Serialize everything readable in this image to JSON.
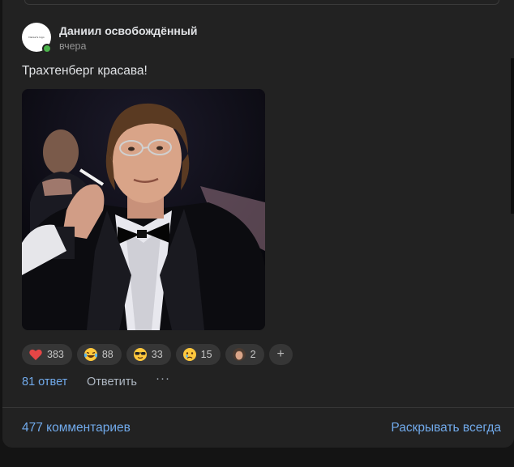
{
  "post": {
    "author": "Даниил освобождённый",
    "time": "вчера",
    "text": "Трахтенберг красава!",
    "avatar_text": "Daniel's logo"
  },
  "reactions": [
    {
      "icon": "heart-icon",
      "count": "383"
    },
    {
      "icon": "laughing-emoji-icon",
      "count": "88"
    },
    {
      "icon": "sunglasses-emoji-icon",
      "count": "33"
    },
    {
      "icon": "crying-emoji-icon",
      "count": "15"
    },
    {
      "icon": "custom-sticker-icon",
      "count": "2"
    }
  ],
  "add_reaction": "+",
  "actions": {
    "replies": "81 ответ",
    "reply": "Ответить",
    "more": "···"
  },
  "footer": {
    "comments": "477 комментариев",
    "expand": "Раскрывать всегда"
  },
  "colors": {
    "accent": "#71aaeb",
    "online": "#4bb34b",
    "card": "#222222"
  }
}
